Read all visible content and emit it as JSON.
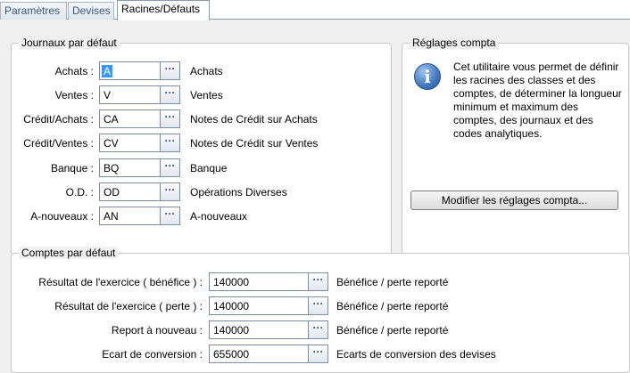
{
  "tabs": [
    {
      "label": "Paramètres"
    },
    {
      "label": "Devises"
    },
    {
      "label": "Racines/Défauts"
    }
  ],
  "journaux": {
    "title": "Journaux par défaut",
    "rows": [
      {
        "label": "Achats :",
        "value": "A",
        "desc": "Achats"
      },
      {
        "label": "Ventes :",
        "value": "V",
        "desc": "Ventes"
      },
      {
        "label": "Crédit/Achats :",
        "value": "CA",
        "desc": "Notes de Crédit sur Achats"
      },
      {
        "label": "Crédit/Ventes :",
        "value": "CV",
        "desc": "Notes de Crédit sur Ventes"
      },
      {
        "label": "Banque :",
        "value": "BQ",
        "desc": "Banque"
      },
      {
        "label": "O.D. :",
        "value": "OD",
        "desc": "Opérations Diverses"
      },
      {
        "label": "A-nouveaux :",
        "value": "AN",
        "desc": "A-nouveaux"
      }
    ]
  },
  "reglages": {
    "title": "Réglages compta",
    "text": "Cet utilitaire vous permet de définir les racines des classes et des comptes, de déterminer la longueur minimum et maximum des comptes, des journaux et des codes analytiques.",
    "icon": "info-icon",
    "button_label": "Modifier les réglages compta..."
  },
  "comptes": {
    "title": "Comptes par défaut",
    "rows": [
      {
        "label": "Résultat de l'exercice ( bénéfice ) :",
        "value": "140000",
        "desc": "Bénéfice / perte reporté"
      },
      {
        "label": "Résultat de l'exercice ( perte ) :",
        "value": "140000",
        "desc": "Bénéfice / perte reporté"
      },
      {
        "label": "Report à nouveau :",
        "value": "140000",
        "desc": "Bénéfice / perte reporté"
      },
      {
        "label": "Ecart de conversion :",
        "value": "655000",
        "desc": "Ecarts de conversion des devises"
      }
    ]
  },
  "ellipsis_label": "···"
}
